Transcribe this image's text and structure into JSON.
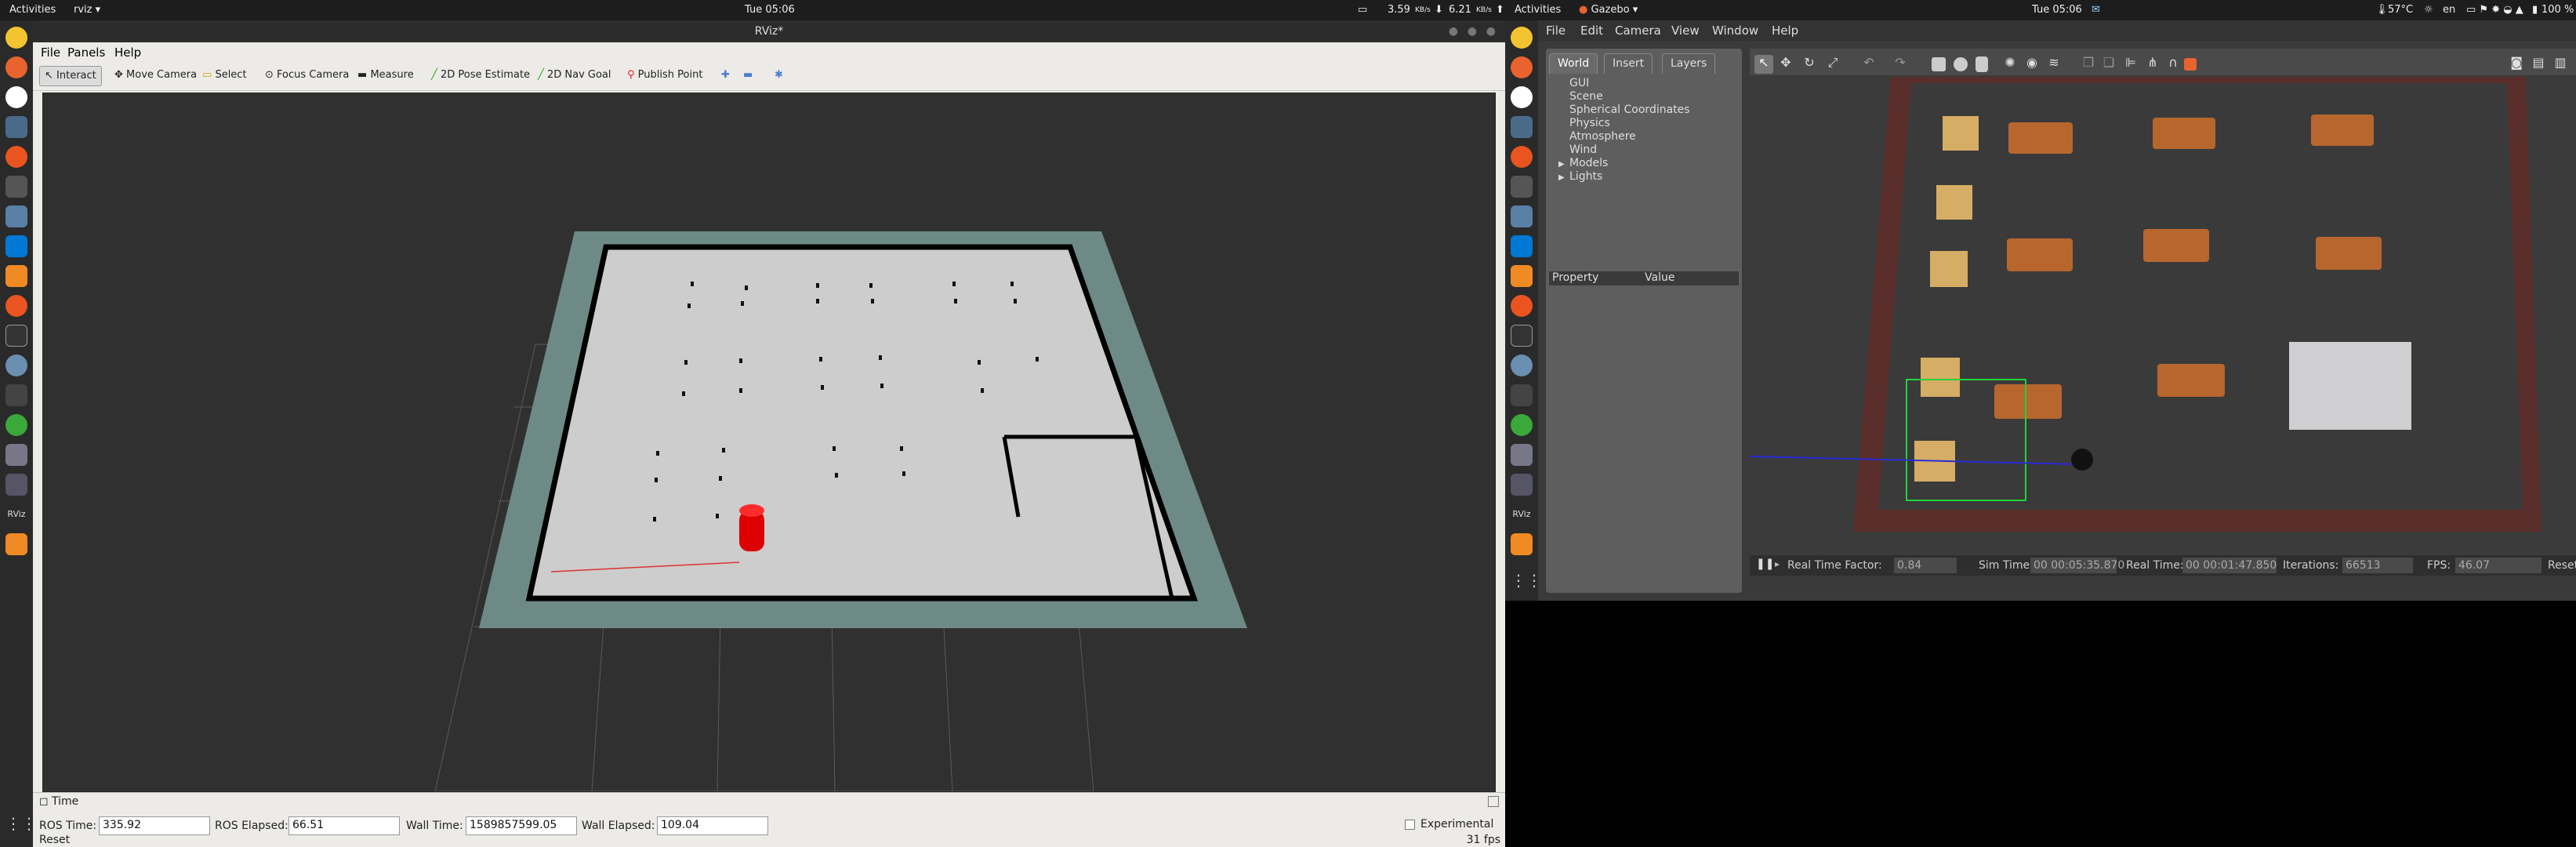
{
  "left_topbar": {
    "activities": "Activities",
    "app_name": "rviz",
    "clock": "Tue 05:06",
    "net_up": "3.59",
    "net_up_unit": "KB/s",
    "net_down": "6.21",
    "net_down_unit": "KB/s"
  },
  "right_topbar": {
    "activities": "Activities",
    "app_name": "Gazebo",
    "clock": "Tue 05:06",
    "temp": "57°C",
    "lang": "en",
    "battery": "100 %"
  },
  "rviz": {
    "title": "RViz*",
    "menu": [
      "File",
      "Panels",
      "Help"
    ],
    "tools": [
      "Interact",
      "Move Camera",
      "Select",
      "Focus Camera",
      "Measure",
      "2D Pose Estimate",
      "2D Nav Goal",
      "Publish Point"
    ],
    "time_panel": {
      "title": "Time",
      "ros_time_label": "ROS Time:",
      "ros_time": "335.92",
      "ros_elapsed_label": "ROS Elapsed:",
      "ros_elapsed": "66.51",
      "wall_time_label": "Wall Time:",
      "wall_time": "1589857599.05",
      "wall_elapsed_label": "Wall Elapsed:",
      "wall_elapsed": "109.04",
      "experimental_label": "Experimental",
      "reset": "Reset",
      "fps": "31 fps"
    }
  },
  "gazebo": {
    "menu": [
      "File",
      "Edit",
      "Camera",
      "View",
      "Window",
      "Help"
    ],
    "tabs": [
      "World",
      "Insert",
      "Layers"
    ],
    "tree": [
      "GUI",
      "Scene",
      "Spherical Coordinates",
      "Physics",
      "Atmosphere",
      "Wind",
      "Models",
      "Lights"
    ],
    "prop_header": [
      "Property",
      "Value"
    ],
    "status": {
      "rtf_label": "Real Time Factor:",
      "rtf": "0.84",
      "sim_label": "Sim Time:",
      "sim": "00 00:05:35.870",
      "real_label": "Real Time:",
      "real": "00 00:01:47.850",
      "iter_label": "Iterations:",
      "iter": "66513",
      "fps_label": "FPS:",
      "fps": "46.07",
      "reset": "Reset T"
    }
  },
  "colors": {
    "topbar": "#1d1d1d",
    "dock": "#2a2a2a",
    "rviz_view": "#303030",
    "map_free": "#cdcdcd",
    "map_unknown": "#6e8a86",
    "robot": "#dd0000",
    "gazebo_panel": "#5e5e5e",
    "gazebo_scene": "#3b3b3b"
  }
}
